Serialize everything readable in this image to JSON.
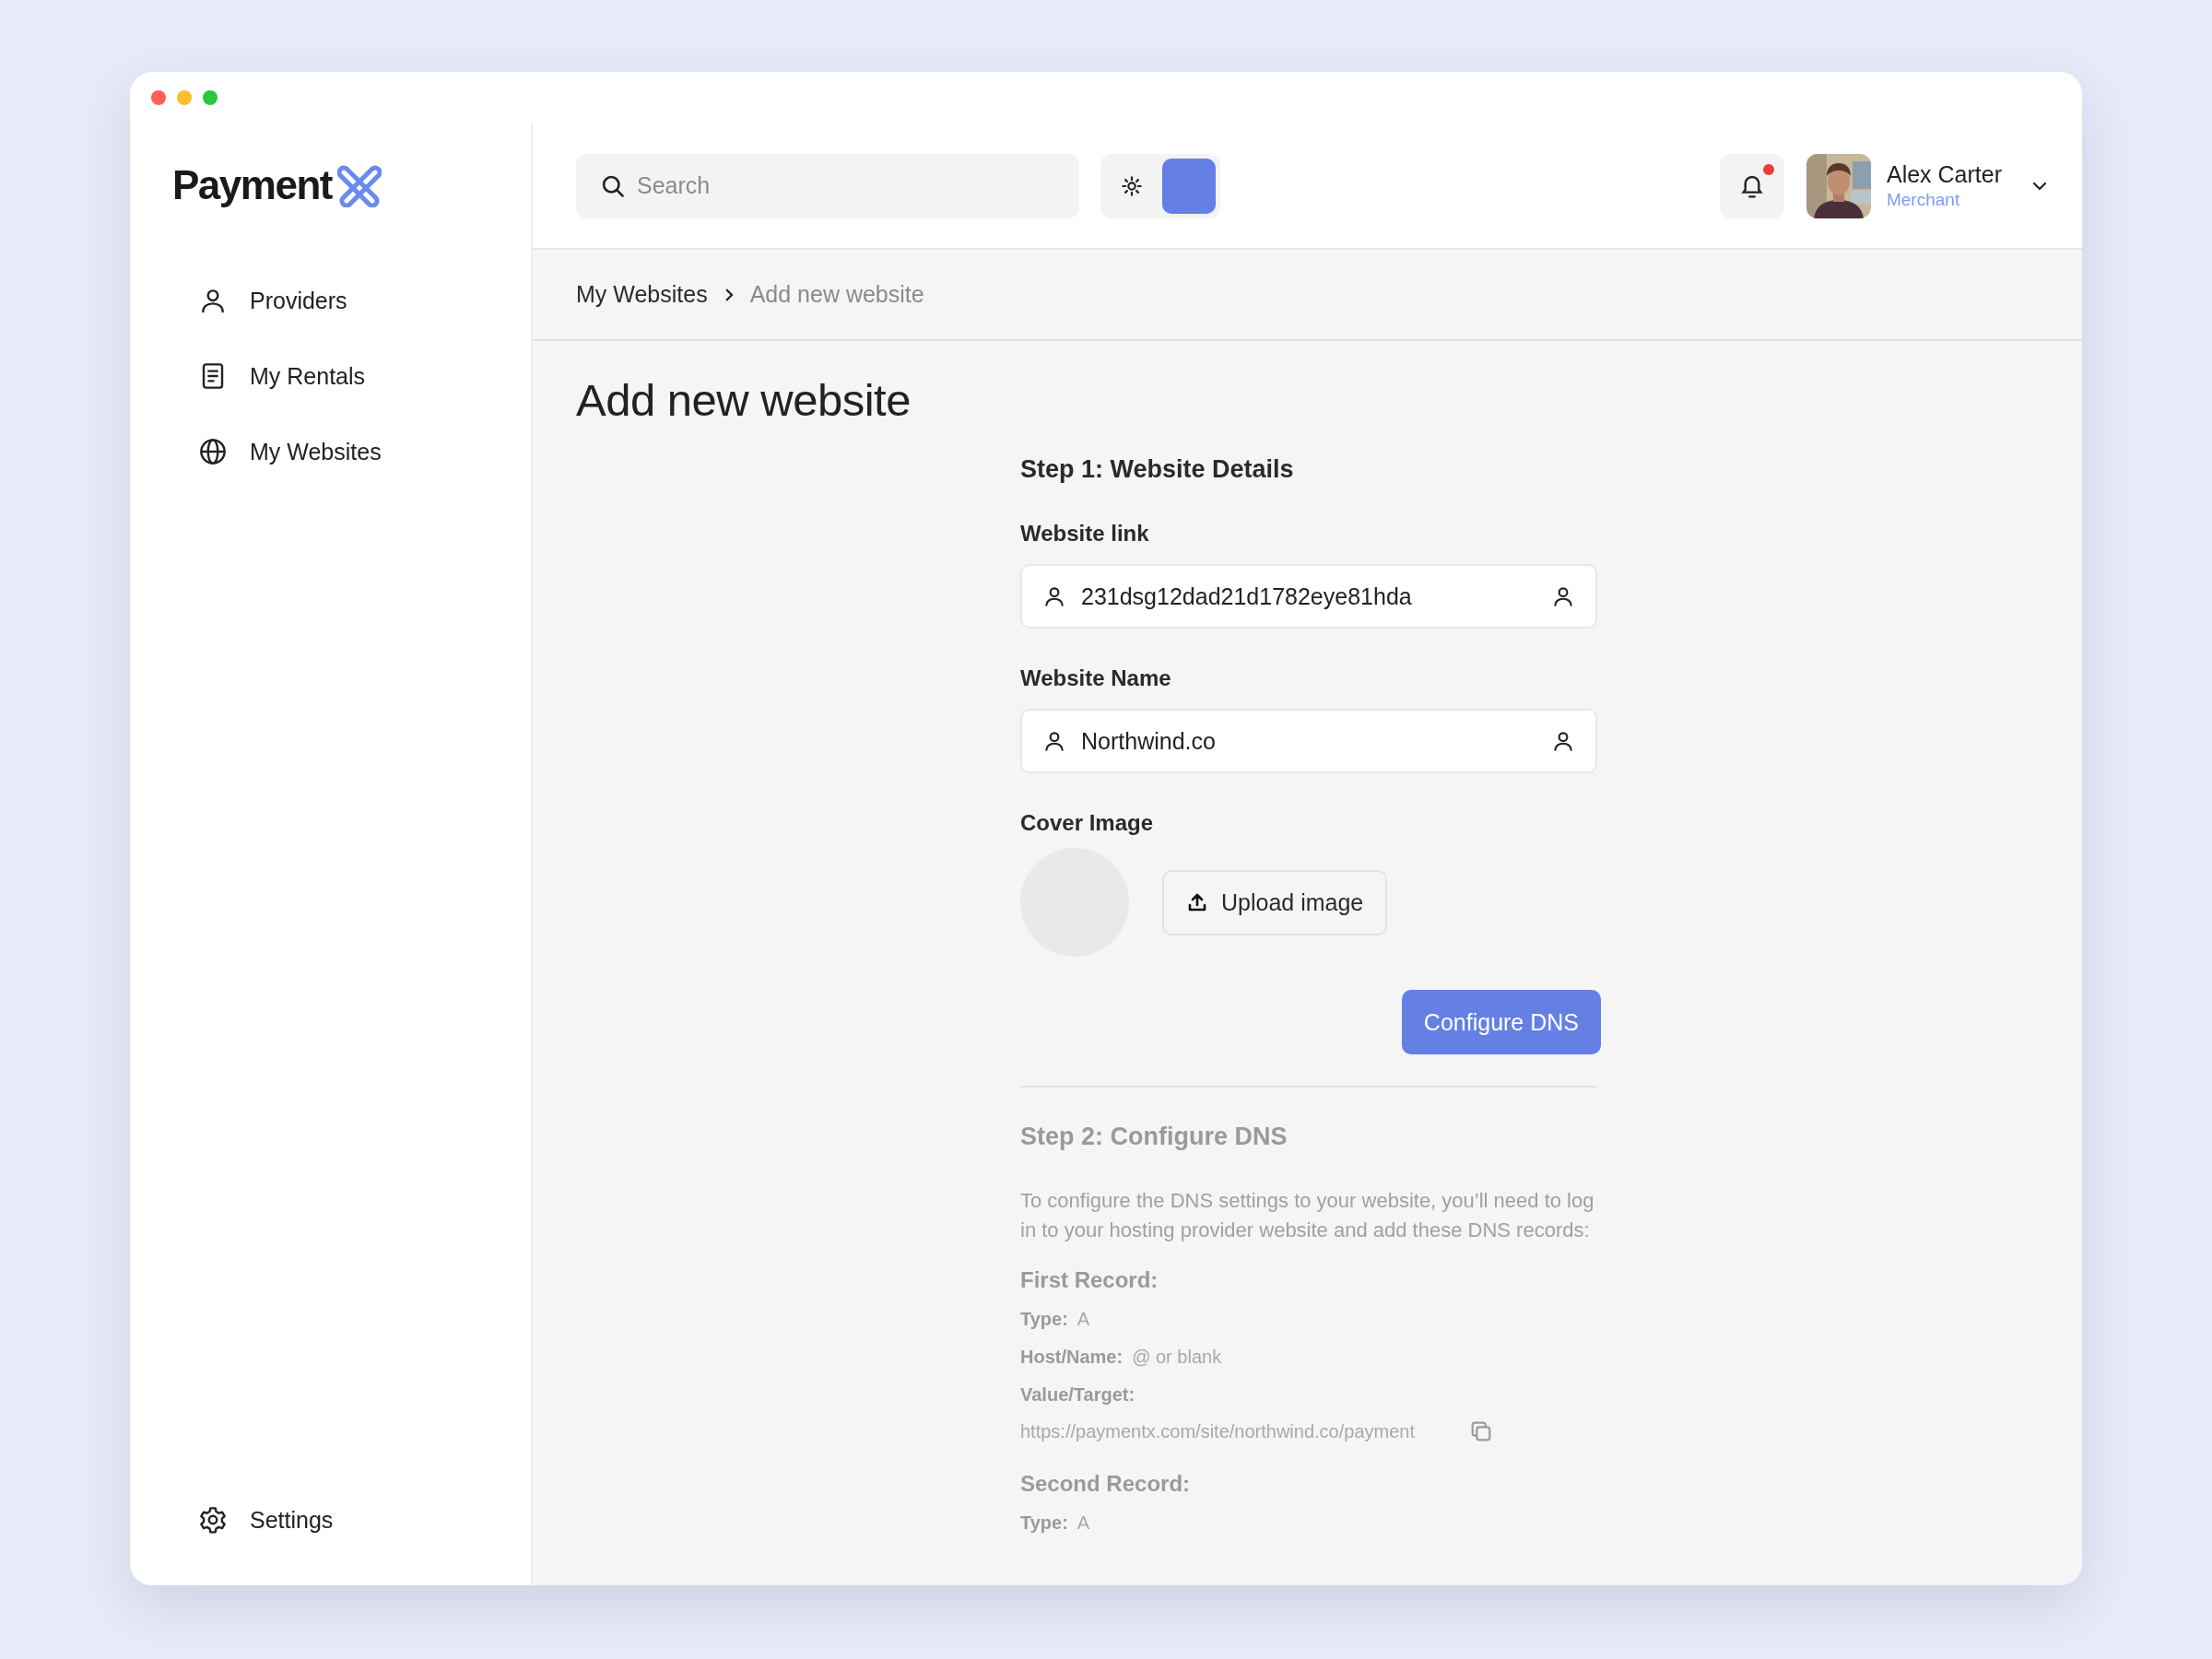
{
  "window_controls": [
    {
      "kind": "close"
    },
    {
      "kind": "minimize"
    },
    {
      "kind": "maximize"
    }
  ],
  "logo": {
    "text": "Payment"
  },
  "sidebar": {
    "items": [
      {
        "label": "Providers",
        "kind": "person"
      },
      {
        "label": "My Rentals",
        "kind": "document"
      },
      {
        "label": "My Websites",
        "kind": "globe"
      }
    ],
    "footer_item": {
      "label": "Settings",
      "kind": "gear"
    }
  },
  "header": {
    "search": {
      "placeholder": "Search"
    },
    "theme_toggle": [
      {
        "kind": "light",
        "selected": false
      },
      {
        "kind": "dark",
        "selected": true
      }
    ],
    "notifications": {
      "unread": true
    },
    "user": {
      "name": "Alex Carter",
      "role": "Merchant"
    }
  },
  "breadcrumb": [
    {
      "label": "My Websites",
      "current": false
    },
    {
      "label": "Add new website",
      "current": true
    }
  ],
  "page_title": "Add new website",
  "step1": {
    "title": "Step 1: Website Details",
    "fields": [
      {
        "label": "Website link",
        "value": "231dsg12dad21d1782eye81hda"
      },
      {
        "label": "Website Name",
        "value": "Northwind.co"
      }
    ],
    "cover_image": {
      "label": "Cover Image",
      "button": "Upload image"
    },
    "submit": "Configure DNS"
  },
  "step2": {
    "title": "Step 2: Configure DNS",
    "description": "To configure the DNS settings to your website, you’ll need to log in to your hosting provider website and add these DNS records:",
    "records": [
      {
        "title": "First Record:",
        "lines": [
          {
            "kind": "inline",
            "label": "Type:",
            "value": "A"
          },
          {
            "kind": "inline",
            "label": "Host/Name:",
            "value": "@ or blank"
          },
          {
            "kind": "copy",
            "label": "Value/Target:",
            "value": "https://paymentx.com/site/northwind.co/payment"
          }
        ]
      },
      {
        "title": "Second Record:",
        "lines": [
          {
            "kind": "inline",
            "label": "Type:",
            "value": "A"
          }
        ]
      }
    ]
  }
}
